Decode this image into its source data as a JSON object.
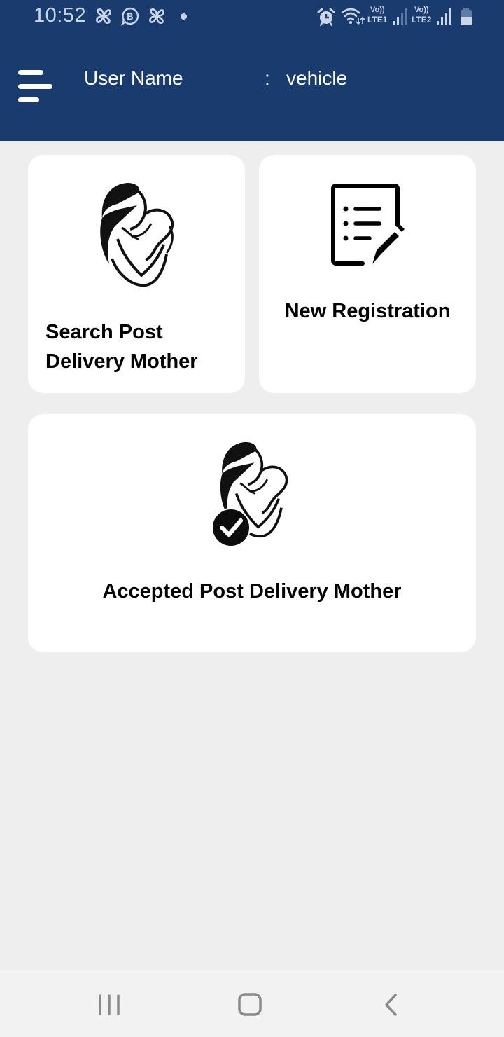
{
  "status_bar": {
    "time": "10:52",
    "left_icons": [
      "pinwheel-icon",
      "business-chat-icon",
      "pinwheel-icon",
      "notification-dot-icon"
    ],
    "right_icons": [
      "alarm-icon",
      "wifi-icon",
      "volte-lte1-signal-icon",
      "volte-lte2-signal-icon",
      "battery-icon"
    ],
    "sim1_label": "LTE1",
    "sim2_label": "LTE2",
    "volte_label": "Vo))"
  },
  "header": {
    "menu_icon": "hamburger-menu-icon",
    "user_label": "User Name",
    "separator": ":",
    "user_value": "vehicle"
  },
  "cards": [
    {
      "id": "search",
      "title": "Search Post Delivery Mother",
      "icon": "mother-baby-icon"
    },
    {
      "id": "new",
      "title": "New Registration",
      "icon": "registration-form-icon"
    },
    {
      "id": "accepted",
      "title": "Accepted Post Delivery Mother",
      "icon": "mother-baby-check-icon"
    }
  ],
  "nav_bar": {
    "recents": "recents-icon",
    "home": "home-icon",
    "back": "back-icon"
  },
  "colors": {
    "header_bg": "#1a3b6e",
    "page_bg": "#eeeeee",
    "card_bg": "#ffffff",
    "nav_icon": "#8a8a8a"
  }
}
